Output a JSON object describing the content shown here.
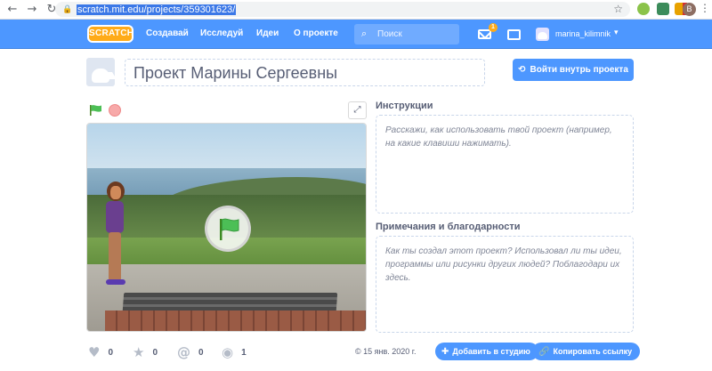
{
  "browser": {
    "back": "←",
    "forward": "→",
    "reload": "↻",
    "url": "scratch.mit.edu/projects/359301623/",
    "avatar_letter": "B",
    "ext_badge": "2"
  },
  "nav": {
    "logo": "SCRATCH",
    "create": "Создавай",
    "explore": "Исследуй",
    "ideas": "Идеи",
    "about": "О проекте",
    "search_placeholder": "Поиск",
    "messages_count": "1",
    "username": "marina_kilimnik"
  },
  "project": {
    "title": "Проект Марины Сергеевны",
    "see_inside": "Войти внутрь проекта",
    "instructions_label": "Инструкции",
    "instructions_placeholder": "Расскажи, как использовать твой проект (например, на какие клавиши нажимать).",
    "notes_label": "Примечания и благодарности",
    "notes_placeholder": "Как ты создал этот проект? Использовал ли ты идеи, программы или рисунки других людей? Поблагодари их здесь.",
    "date": "15 янв. 2020 г."
  },
  "stats": {
    "loves": "0",
    "favorites": "0",
    "remixes": "0",
    "views": "1"
  },
  "actions": {
    "add_to_studio": "Добавить в студию",
    "copy_link": "Копировать ссылку"
  },
  "colors": {
    "scratch_blue": "#4d97ff",
    "logo_orange": "#ffab19",
    "text_grey": "#575e75"
  }
}
